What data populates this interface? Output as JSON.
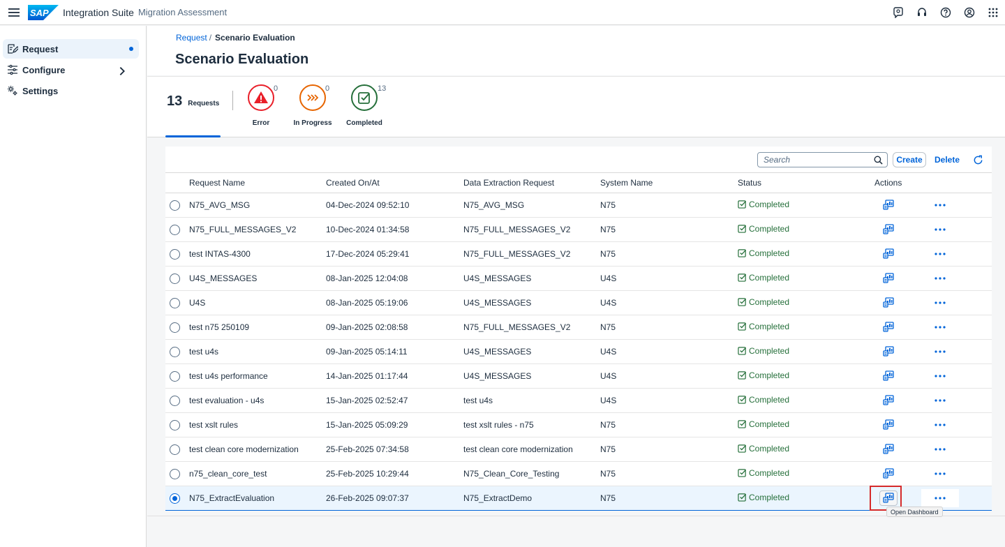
{
  "shell": {
    "app_title": "Integration Suite",
    "app_subtitle": "Migration Assessment",
    "logo_text": "SAP",
    "icons": [
      "menu-icon",
      "feedback-icon",
      "support-icon",
      "help-icon",
      "user-icon",
      "grid-icon"
    ]
  },
  "sidenav": {
    "items": [
      {
        "label": "Request",
        "icon": "edit-request-icon",
        "active": true
      },
      {
        "label": "Configure",
        "icon": "sliders-icon",
        "has_children": true
      },
      {
        "label": "Settings",
        "icon": "gears-icon"
      }
    ]
  },
  "breadcrumb": {
    "link": "Request",
    "separator": "/",
    "current": "Scenario Evaluation"
  },
  "page_title": "Scenario Evaluation",
  "kpis": {
    "total": {
      "value": "13",
      "label": "Requests"
    },
    "items": [
      {
        "label": "Error",
        "count": "0",
        "color": "#e9202a"
      },
      {
        "label": "In Progress",
        "count": "0",
        "color": "#e76500"
      },
      {
        "label": "Completed",
        "count": "13",
        "color": "#256f3a"
      }
    ]
  },
  "toolbar": {
    "search_placeholder": "Search",
    "create_label": "Create",
    "delete_label": "Delete"
  },
  "table": {
    "headers": [
      "Request Name",
      "Created On/At",
      "Data Extraction Request",
      "System Name",
      "Status",
      "Actions"
    ],
    "rows": [
      {
        "name": "N75_AVG_MSG",
        "created": "04-Dec-2024 09:52:10",
        "extraction": "N75_AVG_MSG",
        "system": "N75",
        "status": "Completed"
      },
      {
        "name": "N75_FULL_MESSAGES_V2",
        "created": "10-Dec-2024 01:34:58",
        "extraction": "N75_FULL_MESSAGES_V2",
        "system": "N75",
        "status": "Completed"
      },
      {
        "name": "test INTAS-4300",
        "created": "17-Dec-2024 05:29:41",
        "extraction": "N75_FULL_MESSAGES_V2",
        "system": "N75",
        "status": "Completed"
      },
      {
        "name": "U4S_MESSAGES",
        "created": "08-Jan-2025 12:04:08",
        "extraction": "U4S_MESSAGES",
        "system": "U4S",
        "status": "Completed"
      },
      {
        "name": "U4S",
        "created": "08-Jan-2025 05:19:06",
        "extraction": "U4S_MESSAGES",
        "system": "U4S",
        "status": "Completed"
      },
      {
        "name": "test n75 250109",
        "created": "09-Jan-2025 02:08:58",
        "extraction": "N75_FULL_MESSAGES_V2",
        "system": "N75",
        "status": "Completed"
      },
      {
        "name": "test u4s",
        "created": "09-Jan-2025 05:14:11",
        "extraction": "U4S_MESSAGES",
        "system": "U4S",
        "status": "Completed"
      },
      {
        "name": "test u4s performance",
        "created": "14-Jan-2025 01:17:44",
        "extraction": "U4S_MESSAGES",
        "system": "U4S",
        "status": "Completed"
      },
      {
        "name": "test evaluation - u4s",
        "created": "15-Jan-2025 02:52:47",
        "extraction": "test u4s",
        "system": "U4S",
        "status": "Completed"
      },
      {
        "name": "test xslt rules",
        "created": "15-Jan-2025 05:09:29",
        "extraction": "test xslt rules - n75",
        "system": "N75",
        "status": "Completed"
      },
      {
        "name": "test clean core modernization",
        "created": "25-Feb-2025 07:34:58",
        "extraction": "test clean core modernization",
        "system": "N75",
        "status": "Completed"
      },
      {
        "name": "n75_clean_core_test",
        "created": "25-Feb-2025 10:29:44",
        "extraction": "N75_Clean_Core_Testing",
        "system": "N75",
        "status": "Completed"
      },
      {
        "name": "N75_ExtractEvaluation",
        "created": "26-Feb-2025 09:07:37",
        "extraction": "N75_ExtractDemo",
        "system": "N75",
        "status": "Completed",
        "selected": true
      }
    ]
  },
  "tooltip": "Open Dashboard",
  "colors": {
    "accent": "#0064d9",
    "success": "#256f3a",
    "highlight": "#d52a2a"
  }
}
